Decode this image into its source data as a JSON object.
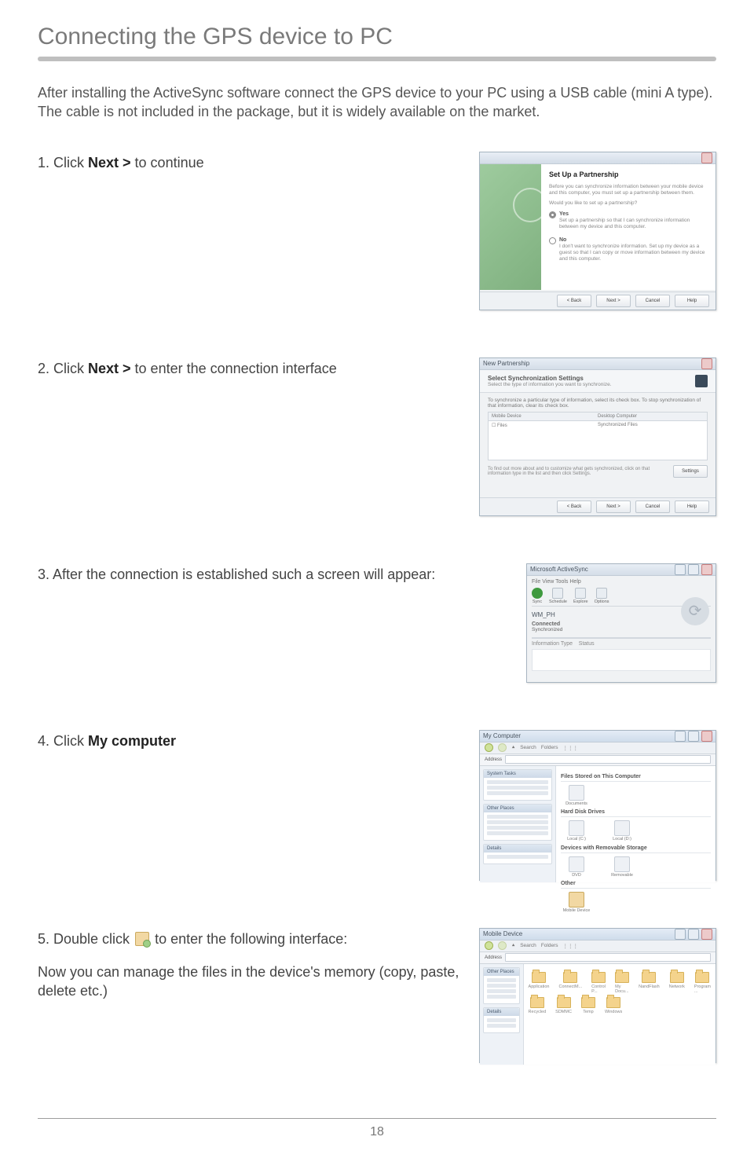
{
  "title": "Connecting the GPS device to PC",
  "intro": "After installing the ActiveSync software connect the GPS device to your PC using a USB cable (mini A type). The cable is not included in the package, but it is widely available on the market.",
  "steps": {
    "s1": {
      "num": "1. ",
      "pre": "Click ",
      "bold": "Next > ",
      "post": "to continue"
    },
    "s2": {
      "num": "2. ",
      "pre": "Click ",
      "bold": "Next > ",
      "post": "to enter the connection interface"
    },
    "s3": {
      "num": "3. ",
      "text": "After the connection is established such a screen will appear:"
    },
    "s4": {
      "num": "4. ",
      "pre": "Click ",
      "bold": "My computer"
    },
    "s5": {
      "num": "5. ",
      "pre": "Double click ",
      "post": " to enter the following interface:",
      "note": "Now you can manage the files in the device's memory (copy, paste, delete etc.)"
    }
  },
  "dlg1": {
    "heading": "Set Up a Partnership",
    "desc": "Before you can synchronize information between your mobile device and this computer, you must set up a partnership between them.",
    "question": "Would you like to set up a partnership?",
    "yes": "Yes",
    "yes_sub": "Set up a partnership so that I can synchronize information between my device and this computer.",
    "no": "No",
    "no_sub": "I don't want to synchronize information. Set up my device as a guest so that I can copy or move information between my device and this computer.",
    "btn_back": "< Back",
    "btn_next": "Next >",
    "btn_cancel": "Cancel",
    "btn_help": "Help"
  },
  "dlg2": {
    "title": "New Partnership",
    "heading": "Select Synchronization Settings",
    "sub": "Select the type of information you want to synchronize.",
    "desc": "To synchronize a particular type of information, select its check box. To stop synchronization of that information, clear its check box.",
    "col1": "Mobile Device",
    "col2": "Desktop Computer",
    "row1": "Files",
    "row1b": "Synchronized Files",
    "hint": "To find out more about and to customize what gets synchronized, click on that information type in the list and then click Settings.",
    "btn_settings": "Settings",
    "btn_back": "< Back",
    "btn_next": "Next >",
    "btn_cancel": "Cancel",
    "btn_help": "Help"
  },
  "as": {
    "title": "Microsoft ActiveSync",
    "menu": "File   View   Tools   Help",
    "tool_sync": "Sync",
    "tool_sched": "Schedule",
    "tool_explore": "Explore",
    "tool_options": "Options",
    "device": "WM_PH",
    "connected": "Connected",
    "synced": "Synchronized",
    "col_a": "Information Type",
    "col_b": "Status"
  },
  "myc": {
    "title": "My Computer",
    "grp1": "Files Stored on This Computer",
    "grp2": "Hard Disk Drives",
    "grp3": "Devices with Removable Storage",
    "grp4": "Other"
  },
  "mob": {
    "title": "Mobile Device"
  },
  "page_number": "18"
}
